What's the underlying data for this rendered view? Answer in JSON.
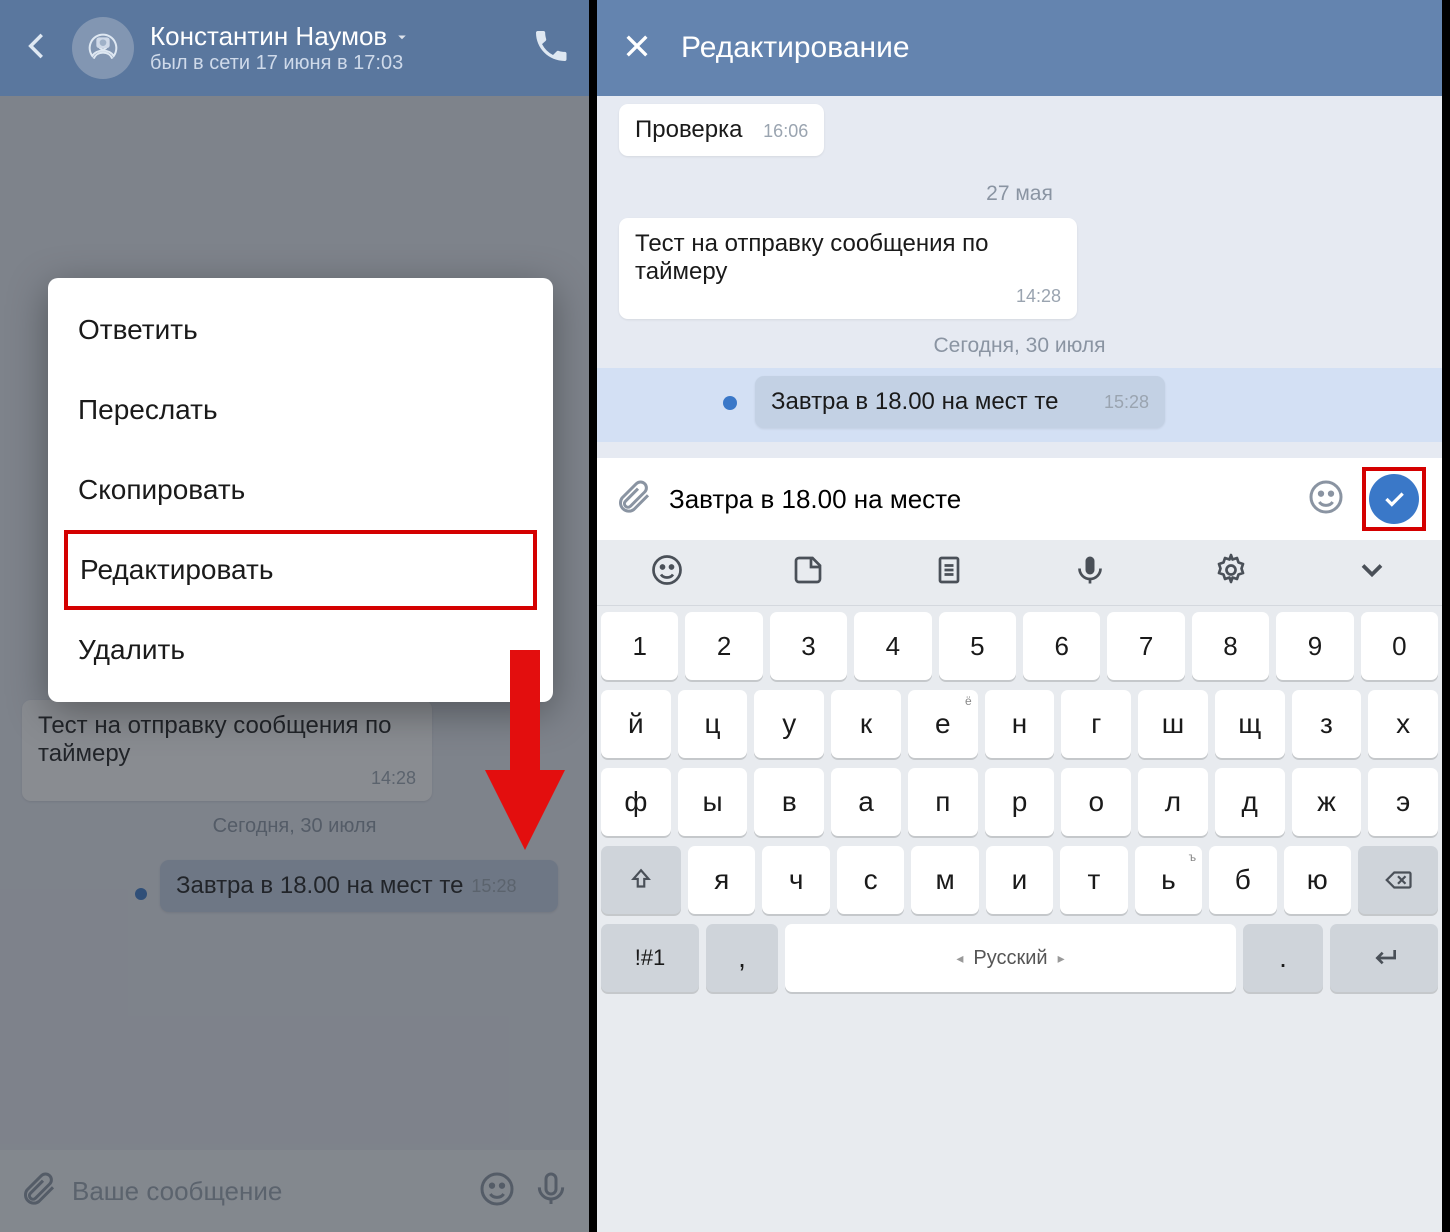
{
  "left": {
    "header": {
      "name": "Константин Наумов",
      "status": "был в сети 17 июня в 17:03"
    },
    "messages": {
      "m1_text": "Тест на отправку сообщения по таймеру",
      "m1_time": "14:28",
      "sep": "Сегодня, 30 июля",
      "m2_text": "Завтра в 18.00 на мест те",
      "m2_time": "15:28"
    },
    "input_placeholder": "Ваше сообщение",
    "popup": {
      "items": [
        "Ответить",
        "Переслать",
        "Скопировать",
        "Редактировать",
        "Удалить"
      ],
      "highlight_index": 3
    }
  },
  "right": {
    "header_title": "Редактирование",
    "m1_text": "Проверка",
    "m1_time": "16:06",
    "sep1": "27 мая",
    "m2_text": "Тест на отправку сообщения по таймеру",
    "m2_time": "14:28",
    "sep2": "Сегодня, 30 июля",
    "m3_text": "Завтра в 18.00 на мест те",
    "m3_time": "15:28",
    "edit_value": "Завтра в 18.00 на месте"
  },
  "keyboard": {
    "row_num": [
      "1",
      "2",
      "3",
      "4",
      "5",
      "6",
      "7",
      "8",
      "9",
      "0"
    ],
    "row1": [
      "й",
      "ц",
      "у",
      "к",
      "е",
      "н",
      "г",
      "ш",
      "щ",
      "з",
      "х"
    ],
    "row1_sup": {
      "4": "ё"
    },
    "row2": [
      "ф",
      "ы",
      "в",
      "а",
      "п",
      "р",
      "о",
      "л",
      "д",
      "ж",
      "э"
    ],
    "row3": [
      "я",
      "ч",
      "с",
      "м",
      "и",
      "т",
      "ь",
      "б",
      "ю"
    ],
    "row3_sup": {
      "6": "ъ"
    },
    "sym_label": "!#1",
    "comma": ",",
    "space_label": "Русский",
    "dot": "."
  }
}
